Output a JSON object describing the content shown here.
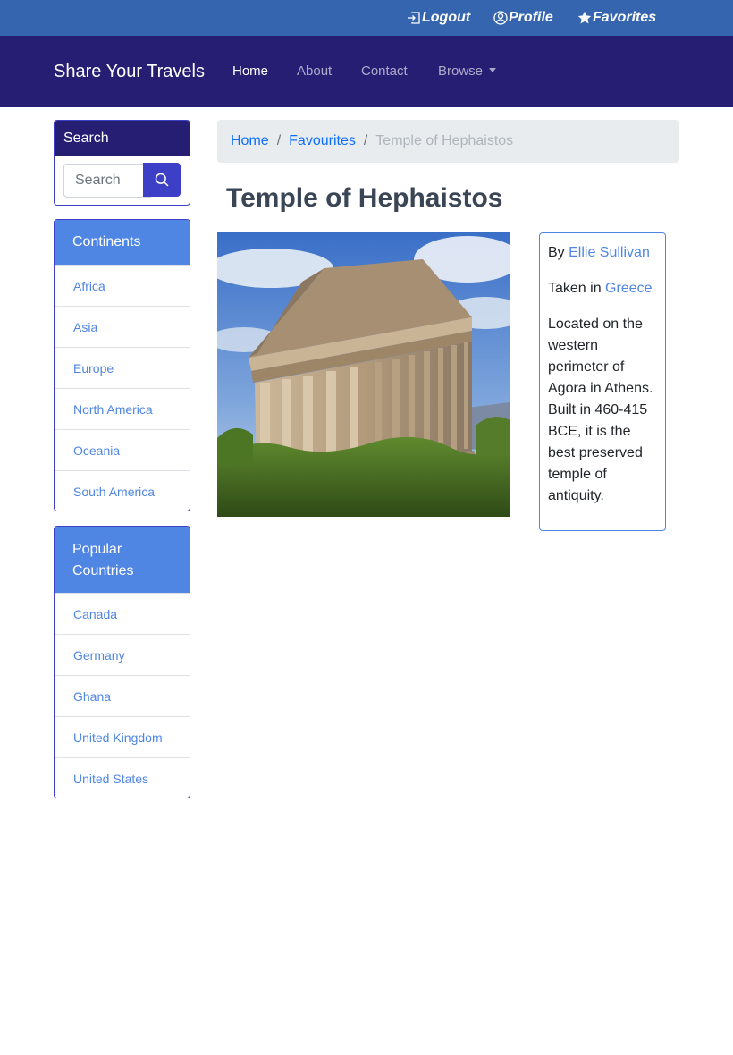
{
  "topbar": {
    "logout": "Logout",
    "profile": "Profile",
    "favorites": "Favorites"
  },
  "navbar": {
    "brand": "Share Your Travels",
    "links": [
      "Home",
      "About",
      "Contact",
      "Browse"
    ],
    "active": "Home"
  },
  "search": {
    "title": "Search",
    "placeholder": "Search"
  },
  "continents": {
    "title": "Continents",
    "items": [
      "Africa",
      "Asia",
      "Europe",
      "North America",
      "Oceania",
      "South America"
    ]
  },
  "countries": {
    "title": "Popular Countries",
    "items": [
      "Canada",
      "Germany",
      "Ghana",
      "United Kingdom",
      "United States"
    ]
  },
  "breadcrumb": {
    "items": [
      "Home",
      "Favourites"
    ],
    "current": "Temple of Hephaistos"
  },
  "photo": {
    "title": "Temple of Hephaistos",
    "by_prefix": "By",
    "author": "Ellie Sullivan",
    "taken_prefix": "Taken in",
    "country": "Greece",
    "description": "Located on the western perimeter of Agora in Athens. Built in 460-415 BCE, it is the best preserved temple of antiquity."
  },
  "colors": {
    "topbar": "#3465ae",
    "navbar": "#261e73",
    "accent": "#3e3fc7",
    "list_header": "#4f86e3",
    "link": "#0d6efd"
  }
}
